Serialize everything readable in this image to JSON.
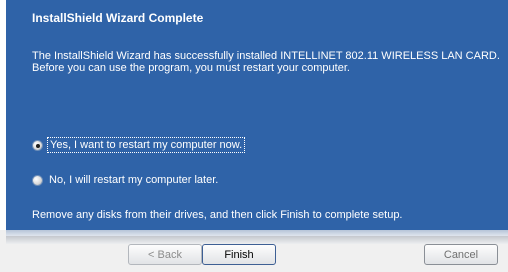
{
  "wizard": {
    "title": "InstallShield Wizard Complete",
    "message_line1": "The InstallShield Wizard has successfully installed INTELLINET 802.11 WIRELESS LAN CARD.",
    "message_line2": "Before you can use the program, you must restart your computer.",
    "options": [
      {
        "label": "Yes, I want to restart my computer now.",
        "selected": true
      },
      {
        "label": "No, I will restart my computer later.",
        "selected": false
      }
    ],
    "footer_note": "Remove any disks from their drives, and then click Finish to complete setup."
  },
  "buttons": {
    "back_label": "< Back",
    "finish_label": "Finish",
    "cancel_label": "Cancel"
  },
  "colors": {
    "panel_background": "#2f63a8",
    "button_bar_background": "#f0f0f0"
  }
}
